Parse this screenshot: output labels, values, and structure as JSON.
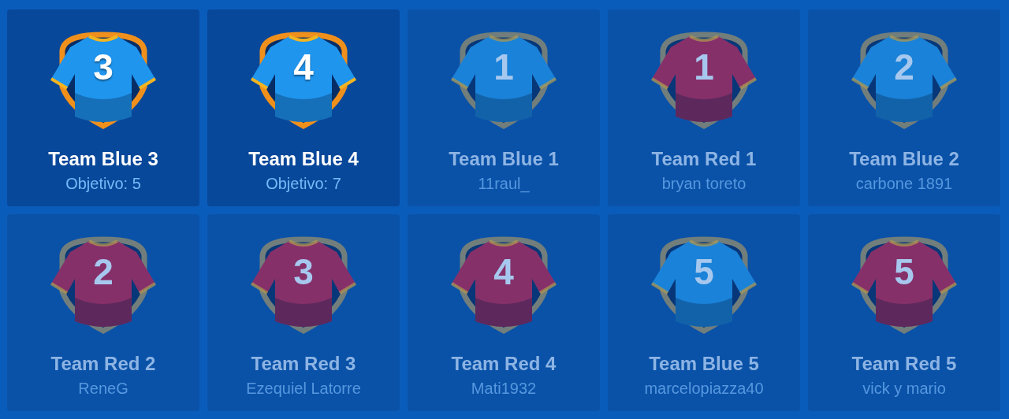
{
  "teams": [
    {
      "color": "#1f95ee",
      "number": "3",
      "name": "Team Blue 3",
      "subtitle": "Objetivo: 5",
      "selected": true
    },
    {
      "color": "#1f95ee",
      "number": "4",
      "name": "Team Blue 4",
      "subtitle": "Objetivo: 7",
      "selected": true
    },
    {
      "color": "#1a82d8",
      "number": "1",
      "name": "Team Blue 1",
      "subtitle": "11raul_",
      "selected": false
    },
    {
      "color": "#86306a",
      "number": "1",
      "name": "Team Red 1",
      "subtitle": "bryan toreto",
      "selected": false
    },
    {
      "color": "#1a82d8",
      "number": "2",
      "name": "Team Blue 2",
      "subtitle": "carbone 1891",
      "selected": false
    },
    {
      "color": "#86306a",
      "number": "2",
      "name": "Team Red 2",
      "subtitle": "ReneG",
      "selected": false
    },
    {
      "color": "#86306a",
      "number": "3",
      "name": "Team Red 3",
      "subtitle": "Ezequiel Latorre",
      "selected": false
    },
    {
      "color": "#86306a",
      "number": "4",
      "name": "Team Red 4",
      "subtitle": "Mati1932",
      "selected": false
    },
    {
      "color": "#1a82d8",
      "number": "5",
      "name": "Team Blue 5",
      "subtitle": "marcelopiazza40",
      "selected": false
    },
    {
      "color": "#86306a",
      "number": "5",
      "name": "Team Red 5",
      "subtitle": "vick y mario",
      "selected": false
    }
  ]
}
